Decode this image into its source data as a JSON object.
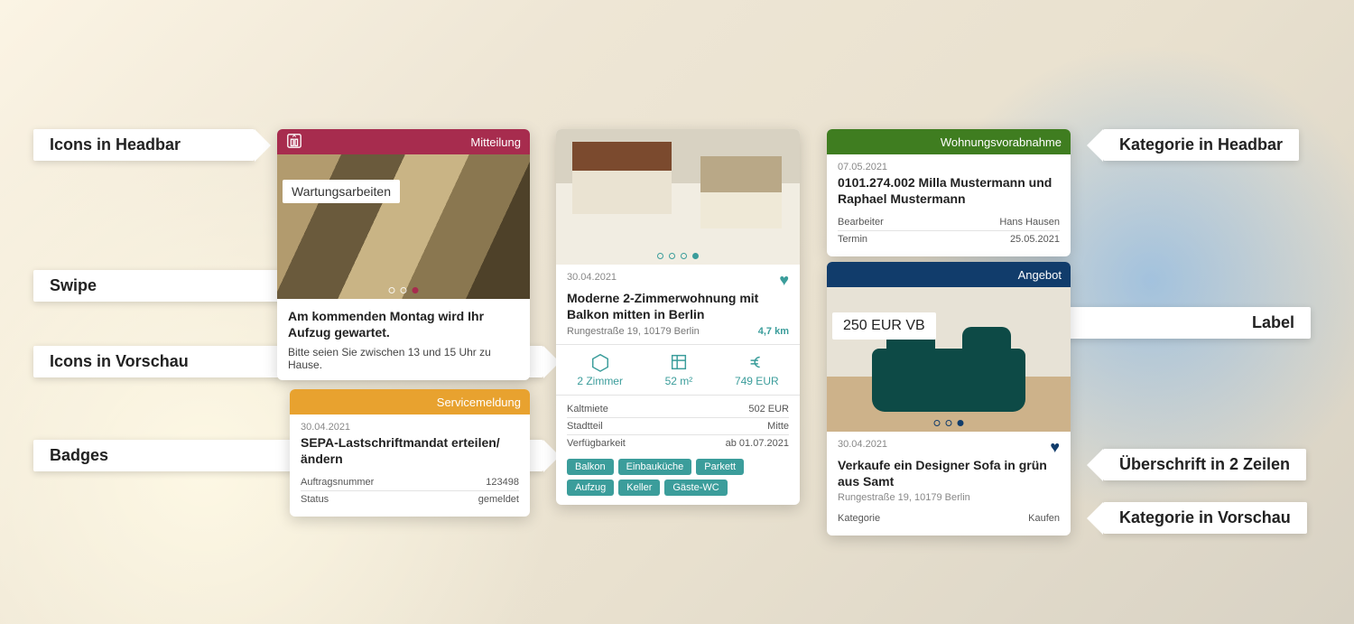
{
  "annotations": {
    "left1": "Icons in Headbar",
    "left2": "Swipe",
    "left3": "Icons in Vorschau",
    "left4": "Badges",
    "right1": "Kategorie in Headbar",
    "right2": "Label",
    "right3": "Überschrift in 2 Zeilen",
    "right4": "Kategorie in Vorschau"
  },
  "card1": {
    "category": "Mitteilung",
    "image_label": "Wartungsarbeiten",
    "title": "Am kommenden Montag wird Ihr Aufzug gewartet.",
    "text": "Bitte seien Sie zwischen 13 und 15 Uhr zu Hause."
  },
  "card2": {
    "category": "Servicemeldung",
    "date": "30.04.2021",
    "title": "SEPA-Lastschriftmandat erteilen/ändern",
    "rows": [
      {
        "k": "Auftragsnummer",
        "v": "123498"
      },
      {
        "k": "Status",
        "v": "gemeldet"
      }
    ]
  },
  "card3": {
    "date": "30.04.2021",
    "title": "Moderne 2-Zimmerwohnung mit Balkon mitten in Berlin",
    "address": "Rungestraße 19, 10179 Berlin",
    "distance": "4,7 km",
    "stats": {
      "rooms": "2 Zimmer",
      "area": "52 m²",
      "price": "749 EUR"
    },
    "rows": [
      {
        "k": "Kaltmiete",
        "v": "502 EUR"
      },
      {
        "k": "Stadtteil",
        "v": "Mitte"
      },
      {
        "k": "Verfügbarkeit",
        "v": "ab 01.07.2021"
      }
    ],
    "badges": [
      "Balkon",
      "Einbauküche",
      "Parkett",
      "Aufzug",
      "Keller",
      "Gäste-WC"
    ]
  },
  "card4": {
    "category": "Wohnungsvorabnahme",
    "date": "07.05.2021",
    "title": "0101.274.002 Milla Mustermann und Raphael Mustermann",
    "rows": [
      {
        "k": "Bearbeiter",
        "v": "Hans Hausen"
      },
      {
        "k": "Termin",
        "v": "25.05.2021"
      }
    ]
  },
  "card5": {
    "category": "Angebot",
    "price_label": "250 EUR VB",
    "date": "30.04.2021",
    "title": "Verkaufe ein Designer Sofa in grün aus Samt",
    "address": "Rungestraße 19, 10179 Berlin",
    "rows": [
      {
        "k": "Kategorie",
        "v": "Kaufen"
      }
    ]
  }
}
